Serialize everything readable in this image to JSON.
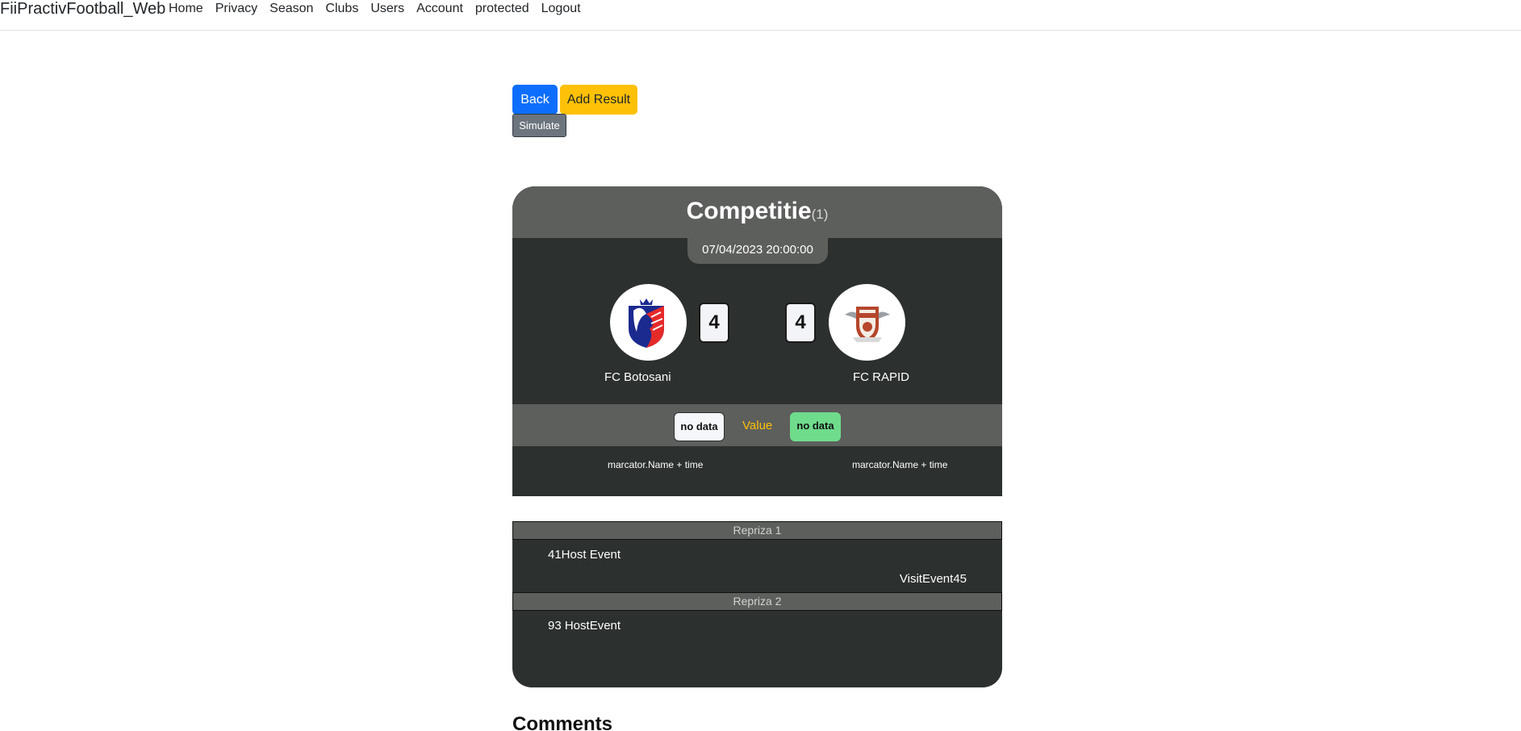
{
  "navbar": {
    "brand": "FiiPractivFootball_Web",
    "links": [
      "Home",
      "Privacy",
      "Season",
      "Clubs",
      "Users",
      "Account",
      "protected",
      "Logout"
    ]
  },
  "actions": {
    "back": "Back",
    "add_result": "Add Result",
    "simulate": "Simulate"
  },
  "match": {
    "competition": "Competitie",
    "competition_count": "(1)",
    "date": "07/04/2023 20:00:00",
    "host": {
      "name": "FC Botosani",
      "score": "4",
      "value": "no data",
      "scorer": "marcator.Name + time"
    },
    "visitor": {
      "name": "FC RAPID",
      "score": "4",
      "value": "no data",
      "scorer": "marcator.Name + time"
    },
    "value_label": "Value"
  },
  "events": {
    "half1": {
      "title": "Repriza 1",
      "items": [
        "41Host Event",
        "VisitEvent45"
      ]
    },
    "half2": {
      "title": "Repriza 2",
      "items": [
        "93 HostEvent"
      ]
    }
  },
  "comments": {
    "title": "Comments"
  },
  "colors": {
    "primary": "#0d6efd",
    "warning": "#ffc107",
    "secondary": "#6c757d",
    "card_dark": "#2c302f",
    "card_band": "#5d5f5c",
    "value_green": "#6fdc8c"
  }
}
